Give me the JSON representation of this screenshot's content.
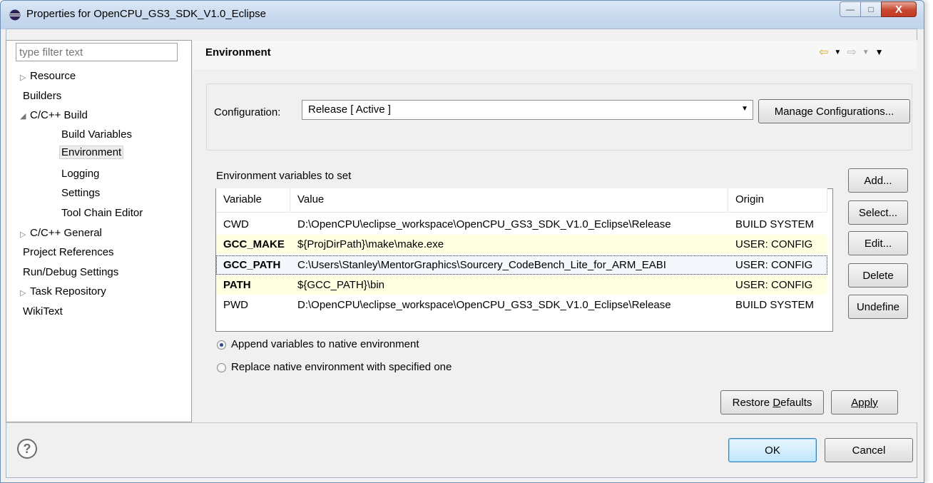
{
  "window": {
    "title": "Properties for OpenCPU_GS3_SDK_V1.0_Eclipse",
    "minimize": "—",
    "maximize": "□",
    "close": "X"
  },
  "filter": {
    "placeholder": "type filter text"
  },
  "tree": [
    {
      "label": "Resource"
    },
    {
      "label": "Builders"
    },
    {
      "label": "C/C++ Build"
    },
    {
      "label": "Build Variables"
    },
    {
      "label": "Environment"
    },
    {
      "label": "Logging"
    },
    {
      "label": "Settings"
    },
    {
      "label": "Tool Chain Editor"
    },
    {
      "label": "C/C++ General"
    },
    {
      "label": "Project References"
    },
    {
      "label": "Run/Debug Settings"
    },
    {
      "label": "Task Repository"
    },
    {
      "label": "WikiText"
    }
  ],
  "page": {
    "title": "Environment",
    "config_label": "Configuration:",
    "config_value": "Release  [ Active ]",
    "manage_button": "Manage Configurations...",
    "env_label": "Environment variables to set"
  },
  "table": {
    "headers": [
      "Variable",
      "Value",
      "Origin"
    ],
    "rows": [
      {
        "variable": "CWD",
        "value": "D:\\OpenCPU\\eclipse_workspace\\OpenCPU_GS3_SDK_V1.0_Eclipse\\Release",
        "origin": "BUILD SYSTEM"
      },
      {
        "variable": "GCC_MAKE",
        "value": "${ProjDirPath}\\make\\make.exe",
        "origin": "USER: CONFIG"
      },
      {
        "variable": "GCC_PATH",
        "value": "C:\\Users\\Stanley\\MentorGraphics\\Sourcery_CodeBench_Lite_for_ARM_EABI",
        "origin": "USER: CONFIG"
      },
      {
        "variable": "PATH",
        "value": "${GCC_PATH}\\bin",
        "origin": "USER: CONFIG"
      },
      {
        "variable": "PWD",
        "value": "D:\\OpenCPU\\eclipse_workspace\\OpenCPU_GS3_SDK_V1.0_Eclipse\\Release",
        "origin": "BUILD SYSTEM"
      }
    ]
  },
  "side_buttons": {
    "add": "Add...",
    "select": "Select...",
    "edit": "Edit...",
    "delete": "Delete",
    "undefine": "Undefine"
  },
  "radios": {
    "append": "Append variables to native environment",
    "replace": "Replace native environment with specified one",
    "selected": "append"
  },
  "buttons": {
    "restore_pre": "Restore ",
    "restore_u": "D",
    "restore_post": "efaults",
    "apply": "Apply",
    "ok": "OK",
    "cancel": "Cancel"
  },
  "icons": {
    "title": "eclipse-icon",
    "help": "help-icon",
    "back": "back-arrow-icon",
    "forward": "forward-arrow-icon",
    "menu": "view-menu-icon"
  },
  "colors": {
    "user_row": "#ffffe1",
    "default_button": "#bee6fd"
  }
}
